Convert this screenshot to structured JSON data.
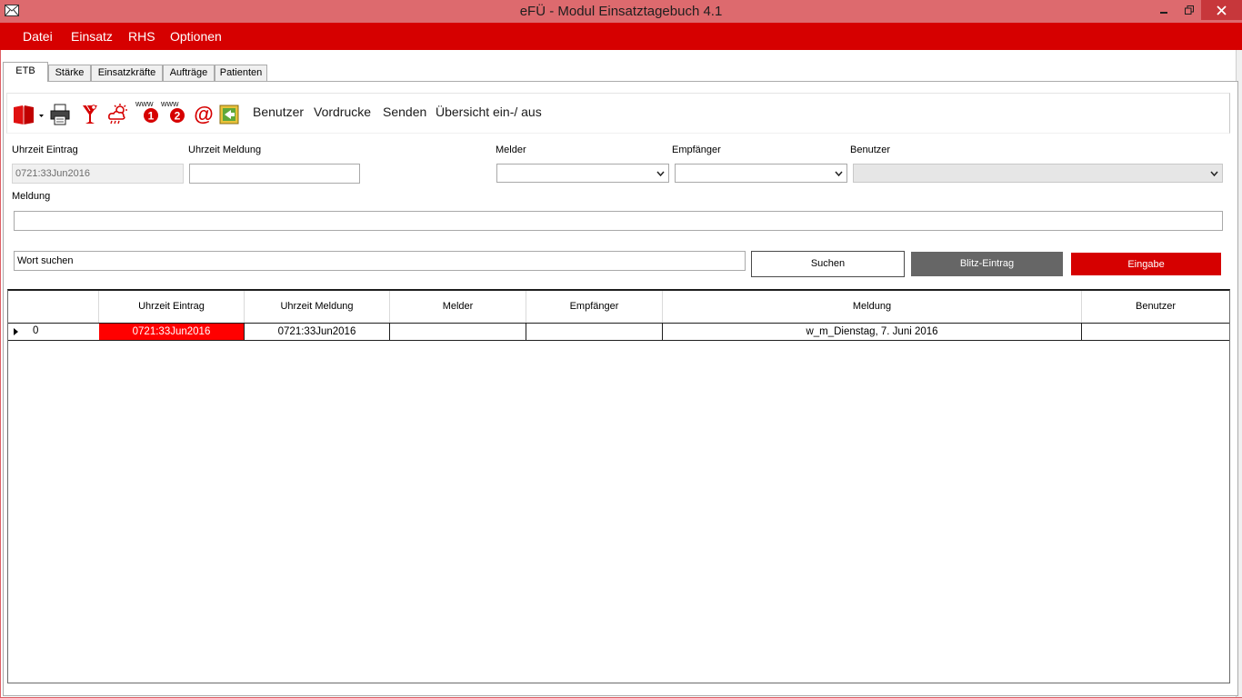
{
  "window": {
    "title": "eFÜ - Modul Einsatztagebuch 4.1"
  },
  "menu": {
    "items": [
      "Datei",
      "Einsatz",
      "RHS",
      "Optionen"
    ]
  },
  "tabs": [
    "ETB",
    "Stärke",
    "Einsatzkräfte",
    "Aufträge",
    "Patienten"
  ],
  "toolbar": {
    "icons": [
      "book-icon",
      "printer-icon",
      "cocktail-icon",
      "weather-icon",
      "www-1-icon",
      "www-2-icon",
      "at-email-icon",
      "exit-icon"
    ],
    "www_label": "www",
    "badge_1": "1",
    "badge_2": "2",
    "at_symbol": "@",
    "links": [
      "Benutzer",
      "Vordrucke",
      "Senden",
      "Übersicht ein-/ aus"
    ]
  },
  "form": {
    "uhrzeit_eintrag_label": "Uhrzeit Eintrag",
    "uhrzeit_eintrag_value": "0721:33Jun2016",
    "uhrzeit_meldung_label": "Uhrzeit Meldung",
    "uhrzeit_meldung_value": "",
    "melder_label": "Melder",
    "empfaenger_label": "Empfänger",
    "benutzer_label": "Benutzer",
    "meldung_label": "Meldung",
    "meldung_value": "",
    "search_value": "Wort suchen"
  },
  "buttons": {
    "suchen": "Suchen",
    "blitz": "Blitz-Eintrag",
    "eingabe": "Eingabe"
  },
  "colors": {
    "accent": "#d60000",
    "titlebar": "#dd6a6e",
    "blitz": "#666666"
  },
  "grid": {
    "columns": [
      "Uhrzeit Eintrag",
      "Uhrzeit Meldung",
      "Melder",
      "Empfänger",
      "Meldung",
      "Benutzer"
    ],
    "rows": [
      {
        "index": "0",
        "uhrzeit_eintrag": "0721:33Jun2016",
        "uhrzeit_meldung": "0721:33Jun2016",
        "melder": "",
        "empfaenger": "",
        "meldung": "w_m_Dienstag, 7. Juni 2016",
        "benutzer": ""
      }
    ]
  }
}
